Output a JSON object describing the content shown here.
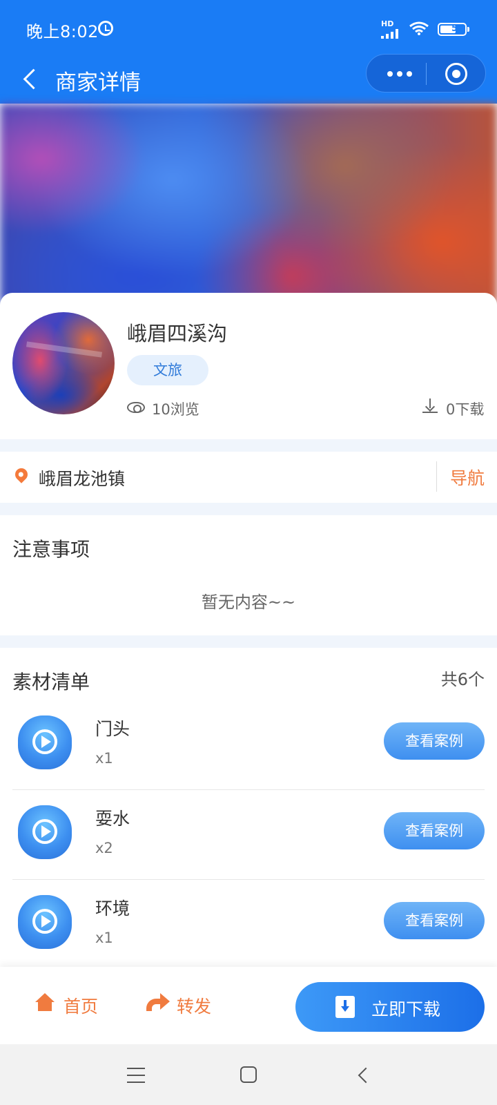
{
  "status_bar": {
    "time": "晚上8:02",
    "network_label": "HD",
    "battery_level": "5"
  },
  "nav": {
    "title": "商家详情"
  },
  "merchant": {
    "name": "峨眉四溪沟",
    "category": "文旅",
    "views": "10浏览",
    "downloads": "0下载"
  },
  "location": {
    "address": "峨眉龙池镇",
    "nav_label": "导航"
  },
  "notice": {
    "title": "注意事项",
    "empty_text": "暂无内容~~"
  },
  "materials": {
    "title": "素材清单",
    "count": "共6个",
    "items": [
      {
        "name": "门头",
        "qty": "x1",
        "button": "查看案例"
      },
      {
        "name": "耍水",
        "qty": "x2",
        "button": "查看案例"
      },
      {
        "name": "环境",
        "qty": "x1",
        "button": "查看案例"
      }
    ]
  },
  "bottom_bar": {
    "home_label": "首页",
    "share_label": "转发",
    "download_label": "立即下载"
  },
  "colors": {
    "primary": "#1a7cf5",
    "accent": "#f07b3f",
    "tag_bg": "#e5f0fd"
  }
}
